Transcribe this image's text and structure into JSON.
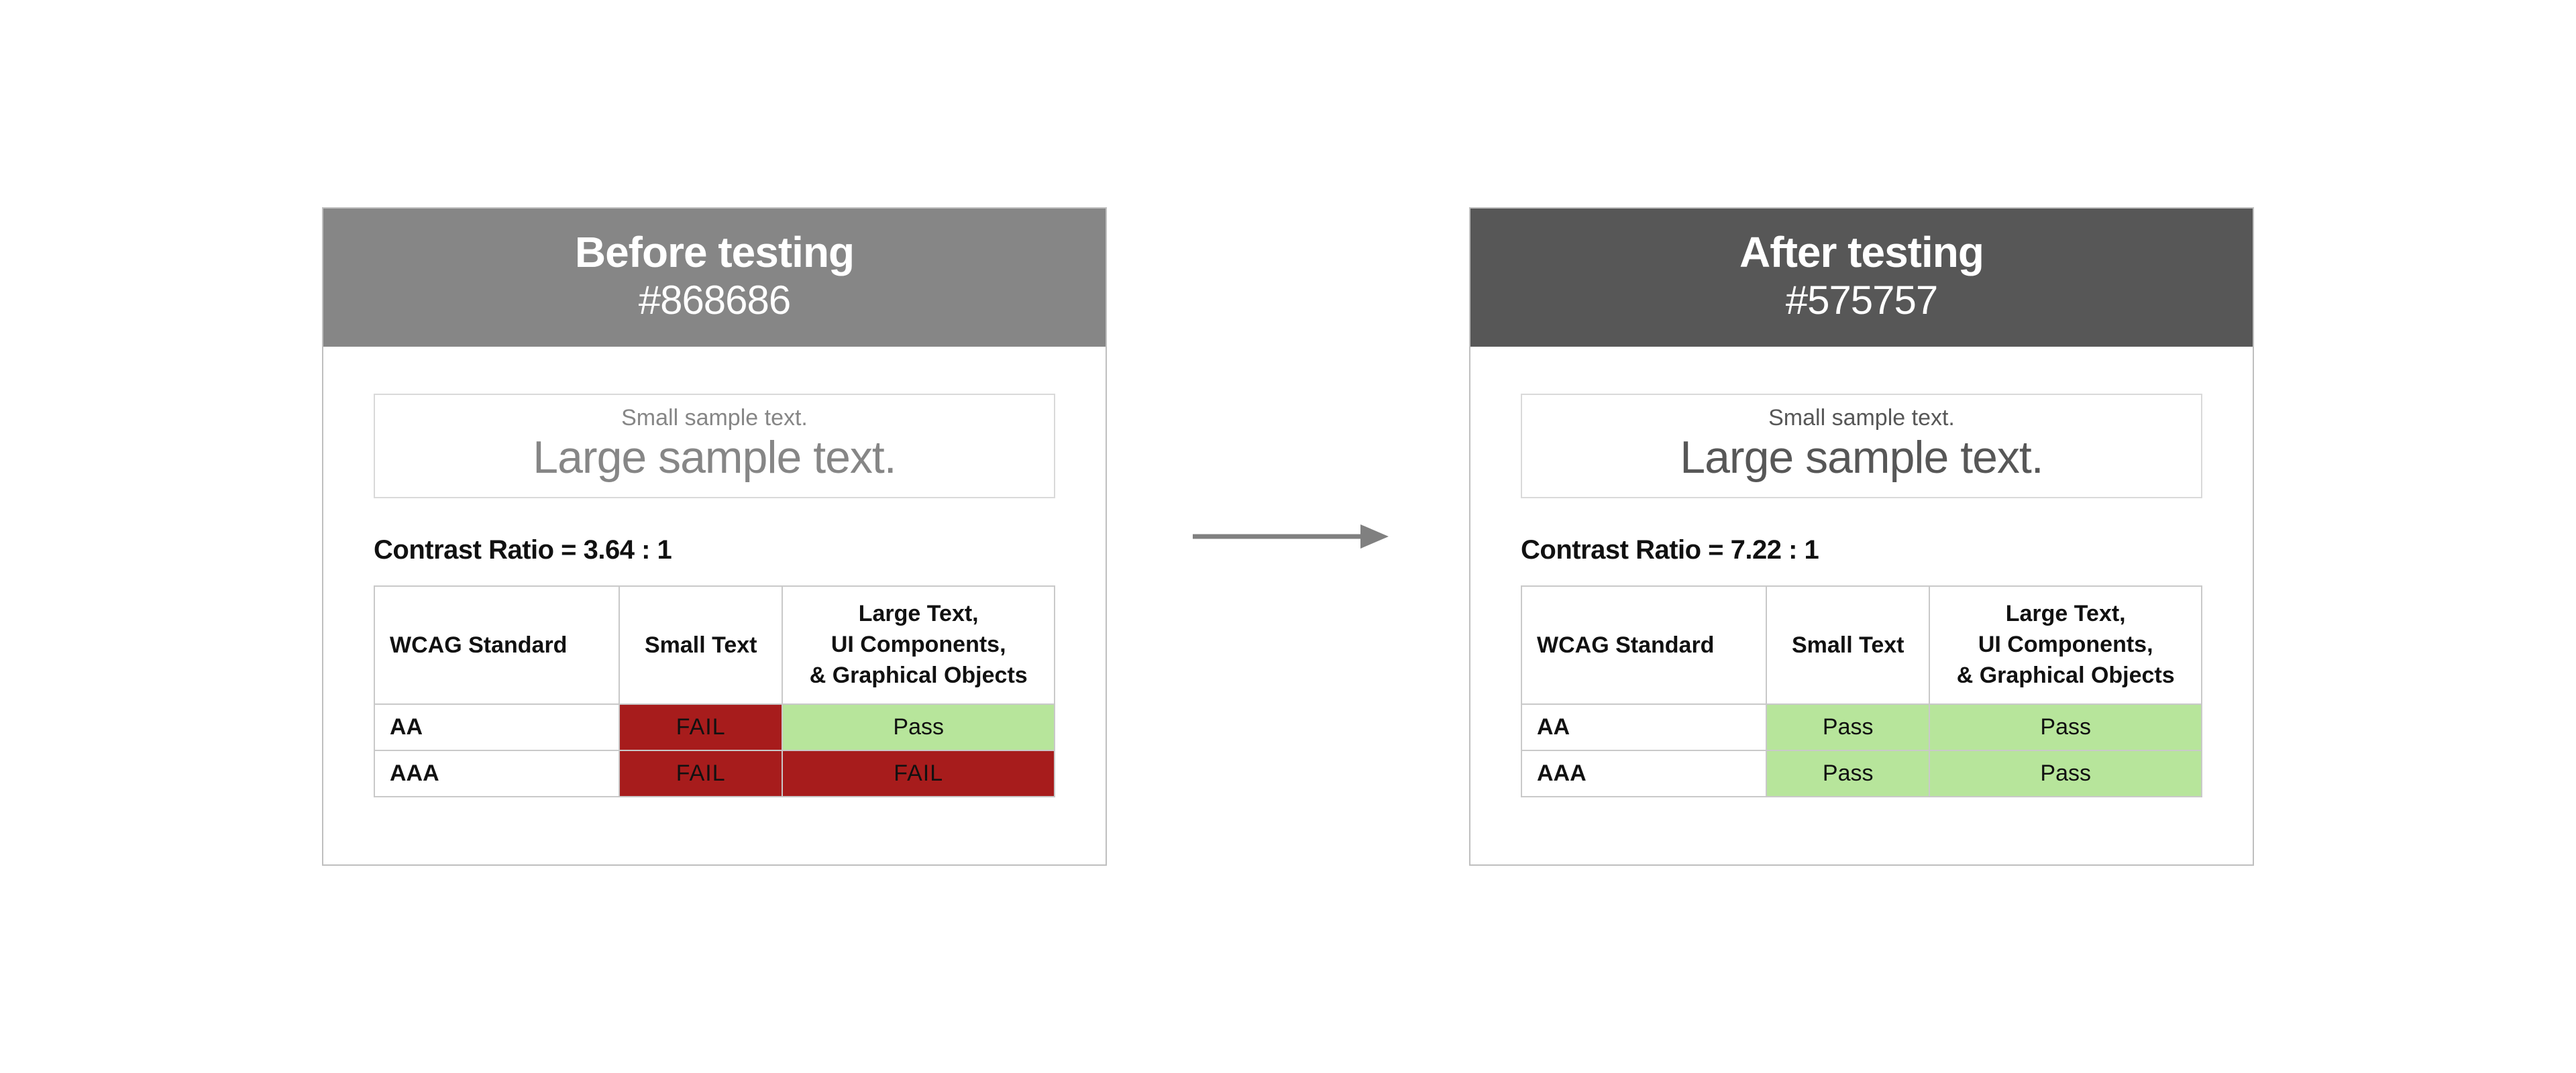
{
  "colors": {
    "pass_bg": "#b7e59b",
    "fail_bg": "#a71c1c",
    "fail_text": "#ffffff",
    "arrow": "#808080"
  },
  "labels": {
    "small_sample": "Small sample text.",
    "large_sample": "Large sample text.",
    "contrast_prefix": "Contrast Ratio = ",
    "col_standard": "WCAG Standard",
    "col_small": "Small Text",
    "col_large_l1": "Large Text,",
    "col_large_l2": "UI Components,",
    "col_large_l3": "& Graphical Objects",
    "row_aa": "AA",
    "row_aaa": "AAA",
    "pass": "Pass",
    "fail": "FAIL"
  },
  "before": {
    "title": "Before testing",
    "hex": "#868686",
    "header_bg": "#868686",
    "sample_color": "#868686",
    "contrast": "3.64 : 1",
    "aa_small": "fail",
    "aa_large": "pass",
    "aaa_small": "fail",
    "aaa_large": "fail"
  },
  "after": {
    "title": "After testing",
    "hex": "#575757",
    "header_bg": "#575757",
    "sample_color": "#575757",
    "contrast": "7.22 : 1",
    "aa_small": "pass",
    "aa_large": "pass",
    "aaa_small": "pass",
    "aaa_large": "pass"
  }
}
